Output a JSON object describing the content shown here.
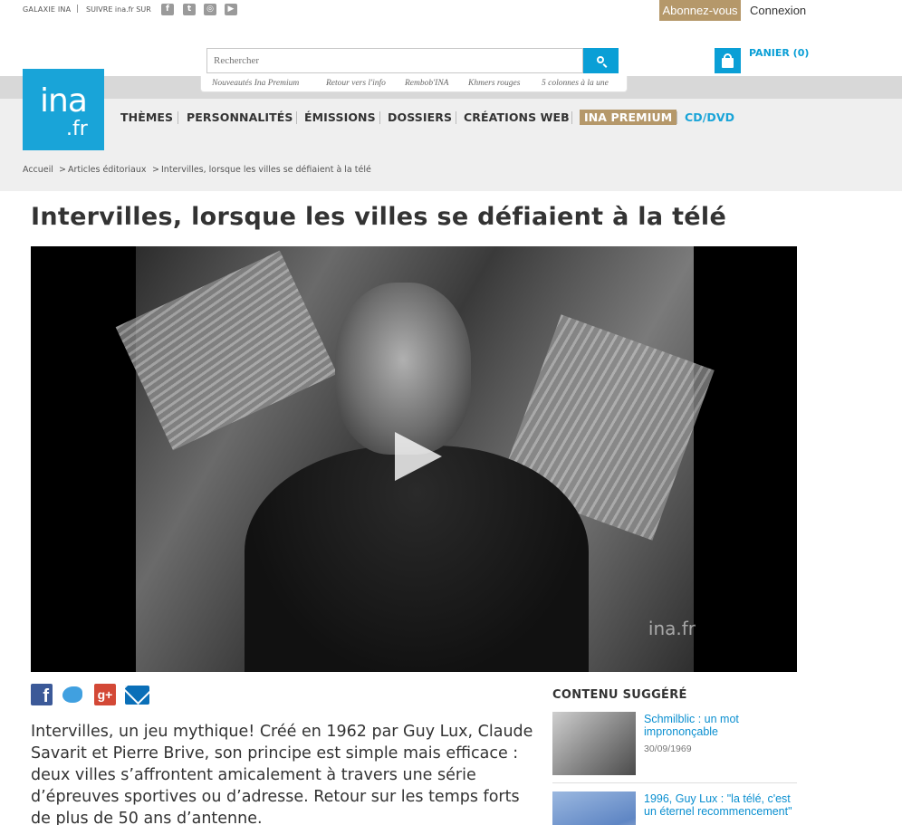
{
  "topbar": {
    "galaxie": "GALAXIE INA",
    "separator": "|",
    "suivre": "SUIVRE ina.fr SUR",
    "social": [
      "facebook-icon",
      "twitter-icon",
      "instagram-icon",
      "youtube-icon"
    ],
    "abonnez": "Abonnez-vous",
    "connexion": "Connexion"
  },
  "search": {
    "placeholder": "Rechercher",
    "quicklinks": [
      "Nouveautés Ina Premium",
      "Retour vers l'info",
      "Rembob'INA",
      "Khmers rouges",
      "5 colonnes à la une"
    ]
  },
  "cart": {
    "label": "PANIER (0)"
  },
  "logo": {
    "main": "ina",
    "suffix": ".fr"
  },
  "nav": {
    "items": [
      "THÈMES",
      "PERSONNALITÉS",
      "ÉMISSIONS",
      "DOSSIERS",
      "CRÉATIONS WEB",
      "INA PREMIUM",
      "CD/DVD"
    ]
  },
  "breadcrumb": {
    "home": "Accueil",
    "section": "Articles éditoriaux",
    "current": "Intervilles, lorsque les villes se défiaient à la télé",
    "sep": ">"
  },
  "article": {
    "title": "Intervilles, lorsque les villes se défiaient à la télé",
    "video_watermark": "ina.fr",
    "intro": "Intervilles, un jeu mythique! Créé en 1962 par Guy Lux, Claude Savarit et Pierre Brive, son principe est simple mais efficace : deux villes s’affrontent amicalement à travers une série d’épreuves sportives ou d’adresse. Retour sur les temps forts de plus de 50 ans d’antenne."
  },
  "sidebar": {
    "title": "CONTENU SUGGÉRÉ",
    "items": [
      {
        "title": "Schmilblic : un mot imprononçable",
        "date": "30/09/1969"
      },
      {
        "title": "1996, Guy Lux : \"la télé, c'est un éternel recommencement\"",
        "date": ""
      }
    ]
  },
  "colors": {
    "accent_blue": "#0a9fd6",
    "premium_gold": "#b5986a",
    "facebook": "#3b5998",
    "googleplus": "#d34836"
  }
}
